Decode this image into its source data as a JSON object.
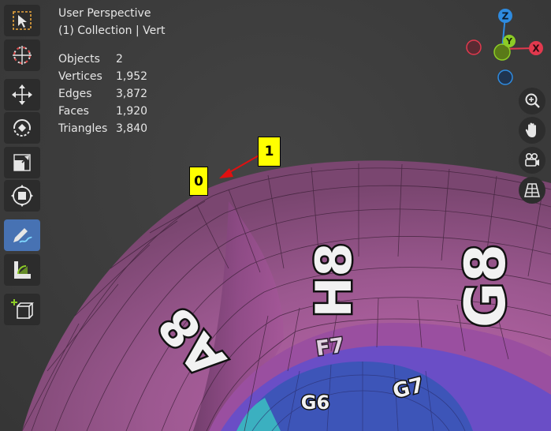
{
  "viewport": {
    "title": "User Perspective",
    "subtitle": "(1) Collection | Vert"
  },
  "stats": [
    {
      "label": "Objects",
      "value": "2"
    },
    {
      "label": "Vertices",
      "value": "1,952"
    },
    {
      "label": "Edges",
      "value": "3,872"
    },
    {
      "label": "Faces",
      "value": "1,920"
    },
    {
      "label": "Triangles",
      "value": "3,840"
    }
  ],
  "toolbar": {
    "tools": [
      {
        "name": "select-box",
        "active": false
      },
      {
        "name": "cursor",
        "active": false
      },
      {
        "name": "move",
        "active": false
      },
      {
        "name": "rotate",
        "active": false
      },
      {
        "name": "scale",
        "active": false
      },
      {
        "name": "transform",
        "active": false
      },
      {
        "name": "annotate",
        "active": true
      },
      {
        "name": "measure",
        "active": false
      },
      {
        "name": "add-cube",
        "active": false
      }
    ]
  },
  "gizmo": {
    "axes": {
      "z": "Z",
      "y": "Y",
      "x": "X"
    },
    "colors": {
      "x": "#e2394e",
      "y": "#8ccc26",
      "z": "#2e8be0"
    }
  },
  "nav_buttons": [
    "zoom-icon",
    "hand-icon",
    "camera-icon",
    "grid-icon"
  ],
  "mesh_labels": {
    "h8": "H8",
    "g8": "G8",
    "a8": "A8",
    "f7": "F7",
    "g7": "G7",
    "g6": "G6"
  },
  "annotations": [
    {
      "label": "1",
      "color": "#ffff00"
    },
    {
      "label": "0",
      "color": "#ffff00"
    }
  ],
  "colors": {
    "active_tool": "#4772b3",
    "mesh_outer": "#a85c95",
    "mesh_inner": "#5b55c8",
    "arrow": "#e01010"
  }
}
